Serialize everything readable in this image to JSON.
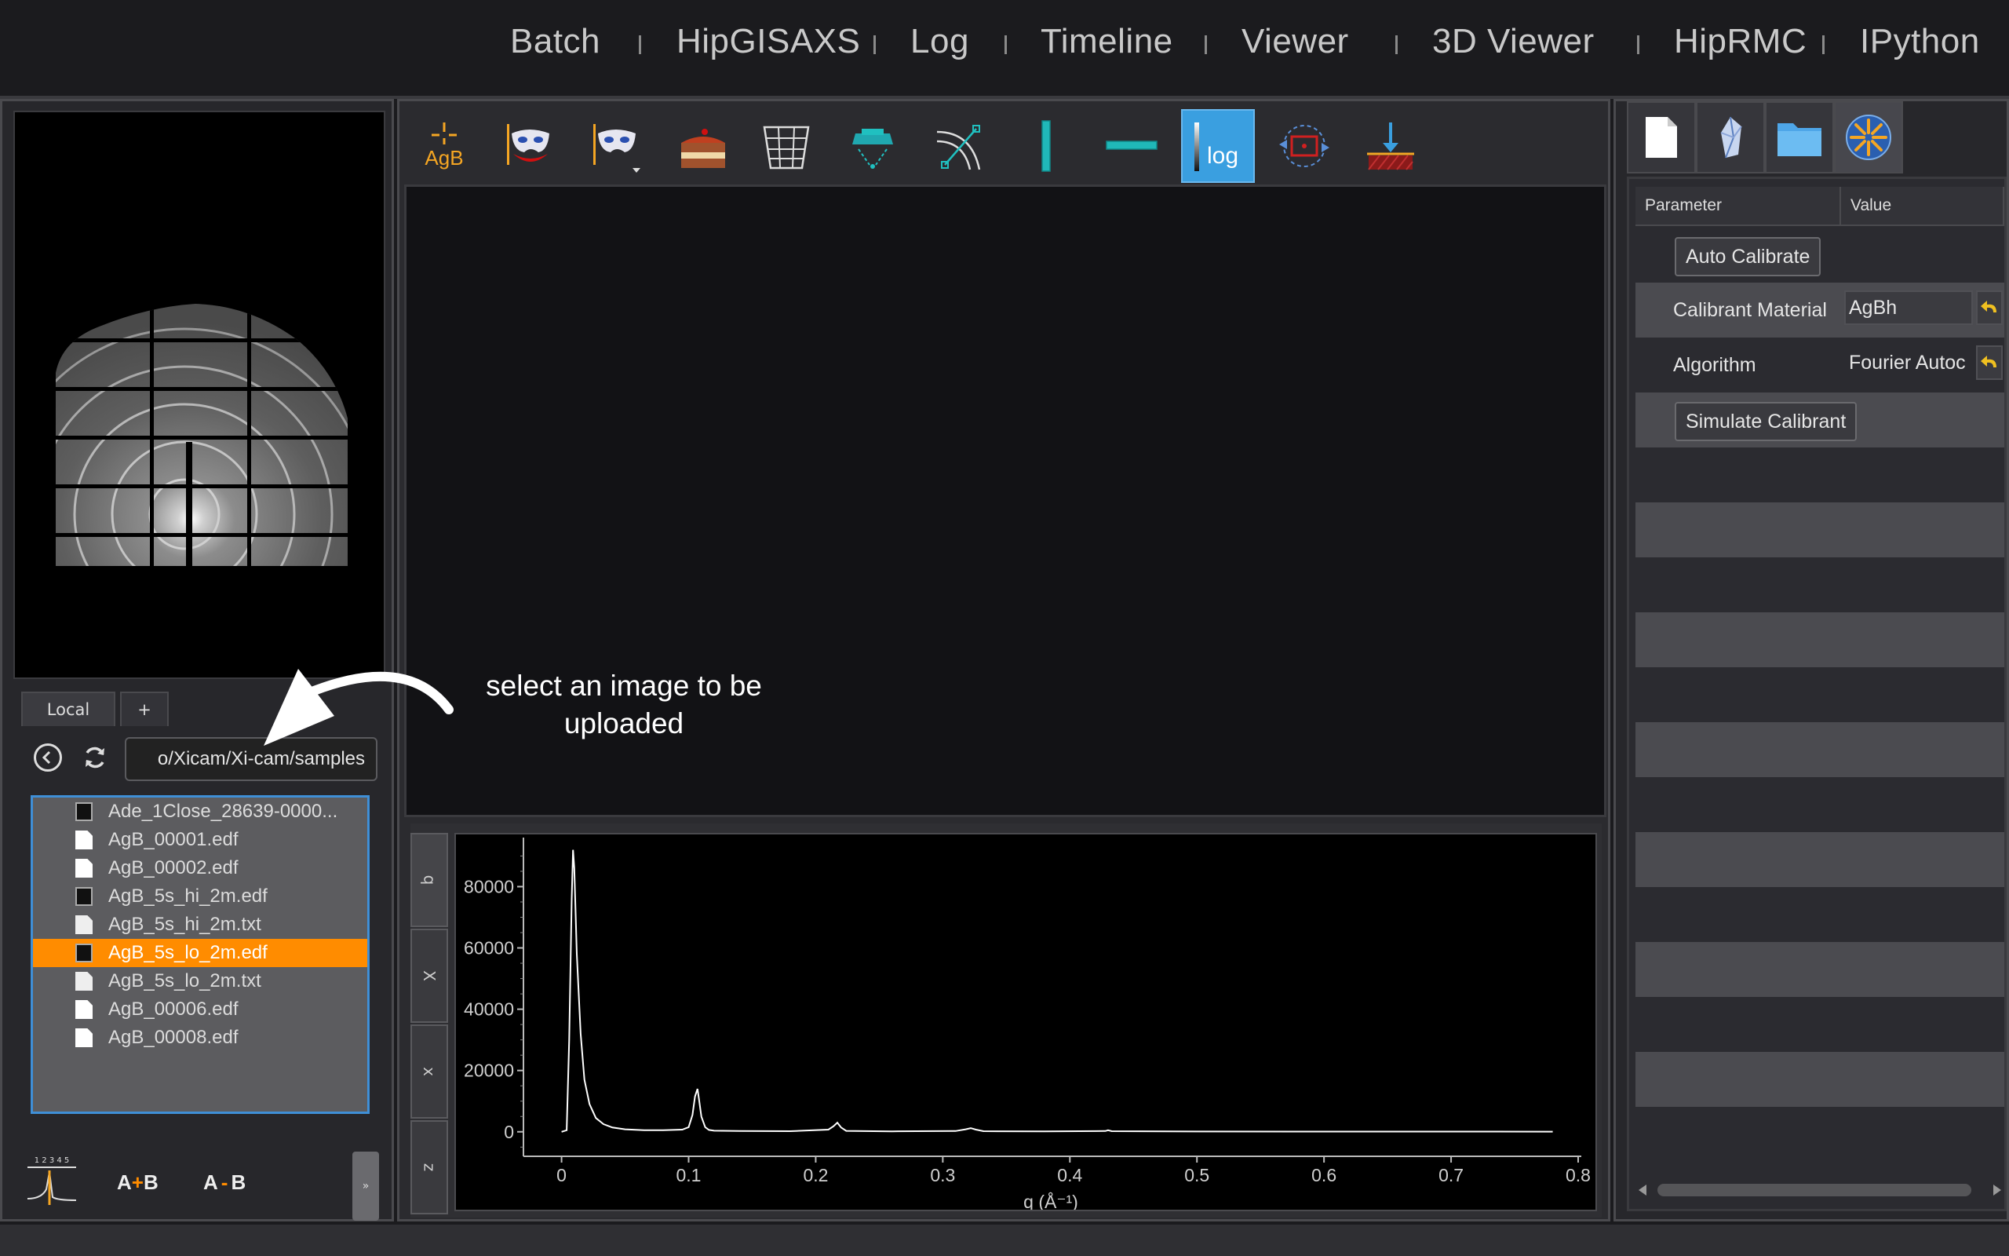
{
  "nav": {
    "items": [
      {
        "label": "Batch"
      },
      {
        "label": "HipGISAXS"
      },
      {
        "label": "Log"
      },
      {
        "label": "Timeline"
      },
      {
        "label": "Viewer"
      },
      {
        "label": "3D Viewer"
      },
      {
        "label": "HipRMC"
      },
      {
        "label": "IPython"
      }
    ]
  },
  "browser": {
    "tabs": [
      {
        "label": "Local"
      },
      {
        "label": "+"
      }
    ],
    "path": "o/Xicam/Xi-cam/samples",
    "files": [
      {
        "name": "Ade_1Close_28639-0000...",
        "icon": "image-file-icon",
        "selected": false
      },
      {
        "name": "AgB_00001.edf",
        "icon": "document-icon",
        "selected": false
      },
      {
        "name": "AgB_00002.edf",
        "icon": "document-icon",
        "selected": false
      },
      {
        "name": "AgB_5s_hi_2m.edf",
        "icon": "image-file-icon",
        "selected": false
      },
      {
        "name": "AgB_5s_hi_2m.txt",
        "icon": "text-file-icon",
        "selected": false
      },
      {
        "name": "AgB_5s_lo_2m.edf",
        "icon": "image-file-icon",
        "selected": true
      },
      {
        "name": "AgB_5s_lo_2m.txt",
        "icon": "text-file-icon",
        "selected": false
      },
      {
        "name": "AgB_00006.edf",
        "icon": "document-icon",
        "selected": false
      },
      {
        "name": "AgB_00008.edf",
        "icon": "document-icon",
        "selected": false
      }
    ],
    "ops": {
      "sum_label_a": "A",
      "sum_op": "+",
      "sum_label_b": "B",
      "diff_label_a": "A",
      "diff_op": "-",
      "diff_label_b": "B"
    },
    "timeline_icon_digits": "1 2 3 4 5"
  },
  "toolbar": {
    "agb_label": "AgB",
    "log_label": "log",
    "tools": [
      "calibrate-agb-icon",
      "mask-icon",
      "mask-dropdown-icon",
      "cake-icon",
      "waterfall-icon",
      "remesh-icon",
      "arc-roi-icon",
      "vertical-cut-icon",
      "horizontal-cut-icon",
      "log-scale-icon",
      "center-refine-icon",
      "background-subtract-icon"
    ],
    "active_tool": "log-scale-icon"
  },
  "plot": {
    "tabs": [
      "q",
      "X",
      "x",
      "z"
    ]
  },
  "chart_data": {
    "type": "line",
    "xlabel": "q (Å⁻¹)",
    "ylabel": "",
    "xlim": [
      -0.03,
      0.8
    ],
    "ylim": [
      -8000,
      96000
    ],
    "xticks": [
      0,
      0.1,
      0.2,
      0.3,
      0.4,
      0.5,
      0.6,
      0.7,
      0.8
    ],
    "xtick_labels": [
      "0",
      "0.1",
      "0.2",
      "0.3",
      "0.4",
      "0.5",
      "0.6",
      "0.7",
      "0.8"
    ],
    "yticks": [
      0,
      20000,
      40000,
      60000,
      80000
    ],
    "ytick_labels": [
      "0",
      "20000",
      "40000",
      "60000",
      "80000"
    ],
    "series": [
      {
        "color": "#ffffff",
        "x": [
          0.0,
          0.004,
          0.006,
          0.008,
          0.009,
          0.01,
          0.012,
          0.015,
          0.018,
          0.022,
          0.027,
          0.033,
          0.04,
          0.05,
          0.065,
          0.08,
          0.095,
          0.1,
          0.103,
          0.105,
          0.107,
          0.108,
          0.11,
          0.113,
          0.116,
          0.12,
          0.14,
          0.18,
          0.21,
          0.214,
          0.217,
          0.22,
          0.224,
          0.26,
          0.31,
          0.318,
          0.322,
          0.326,
          0.332,
          0.38,
          0.428,
          0.43,
          0.433,
          0.5,
          0.6,
          0.7,
          0.78
        ],
        "y": [
          0,
          500,
          30000,
          76000,
          92000,
          86000,
          58000,
          32000,
          17000,
          9000,
          4500,
          2500,
          1400,
          800,
          500,
          500,
          700,
          1500,
          5500,
          11500,
          14000,
          11000,
          5000,
          1500,
          600,
          350,
          250,
          200,
          700,
          1800,
          3000,
          1400,
          300,
          150,
          250,
          800,
          1200,
          700,
          200,
          120,
          250,
          500,
          200,
          100,
          80,
          60,
          50
        ]
      }
    ]
  },
  "params": {
    "header_param": "Parameter",
    "header_value": "Value",
    "auto_calibrate": "Auto Calibrate",
    "calibrant_label": "Calibrant Material",
    "calibrant_value": "AgBh",
    "algorithm_label": "Algorithm",
    "algorithm_value": "Fourier Autoc",
    "simulate": "Simulate Calibrant"
  },
  "annotation": {
    "text": "select an image to be uploaded"
  },
  "colors": {
    "accent": "#3a9fe0",
    "selection": "#ff8c00",
    "cyan_tool": "#20c0c0",
    "orange_tool": "#f5a623"
  }
}
